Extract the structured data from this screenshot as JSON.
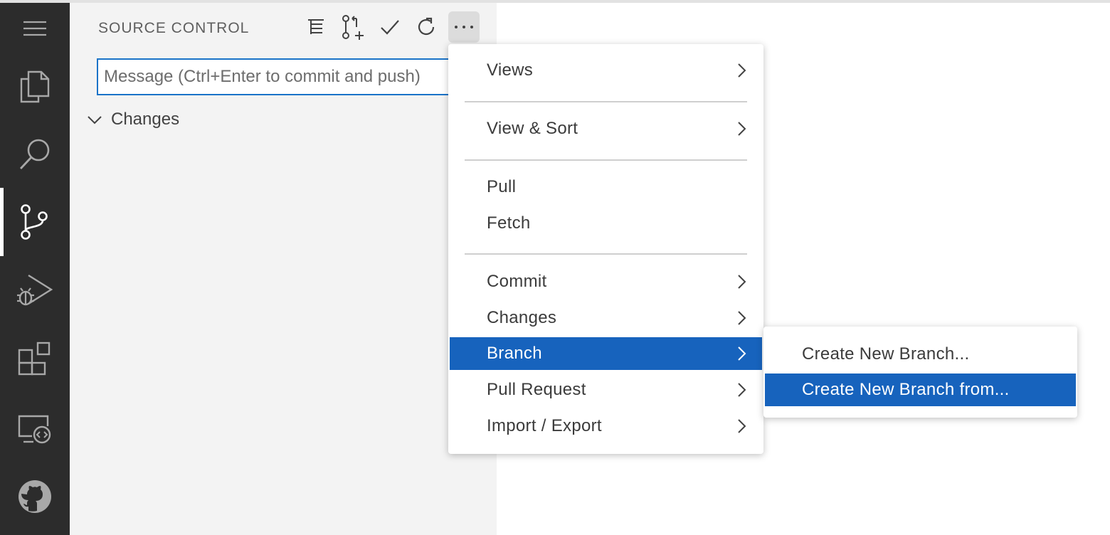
{
  "sidebar": {
    "title": "SOURCE CONTROL",
    "message_placeholder": "Message (Ctrl+Enter to commit and push)",
    "changes_label": "Changes"
  },
  "activity_bar": {
    "items": [
      "menu-icon",
      "explorer-icon",
      "search-icon",
      "source-control-icon",
      "run-debug-icon",
      "extensions-icon",
      "remote-explorer-icon",
      "github-icon"
    ],
    "active": "source-control-icon"
  },
  "toolbar": {
    "icons": [
      "view-as-tree-icon",
      "create-pull-request-icon",
      "commit-check-icon",
      "refresh-icon",
      "more-actions-icon"
    ]
  },
  "menu": {
    "views": "Views",
    "view_sort": "View & Sort",
    "pull": "Pull",
    "fetch": "Fetch",
    "commit": "Commit",
    "changes": "Changes",
    "branch": "Branch",
    "pull_request": "Pull Request",
    "import_export": "Import / Export",
    "selected": "Branch"
  },
  "submenu": {
    "create_new_branch": "Create New Branch...",
    "create_new_branch_from": "Create New Branch from...",
    "selected": "Create New Branch from..."
  },
  "colors": {
    "activity_bar_bg": "#2c2c2c",
    "sidebar_bg": "#f3f3f3",
    "selection_bg": "#1763bd",
    "focus_border": "#1a73c8"
  }
}
